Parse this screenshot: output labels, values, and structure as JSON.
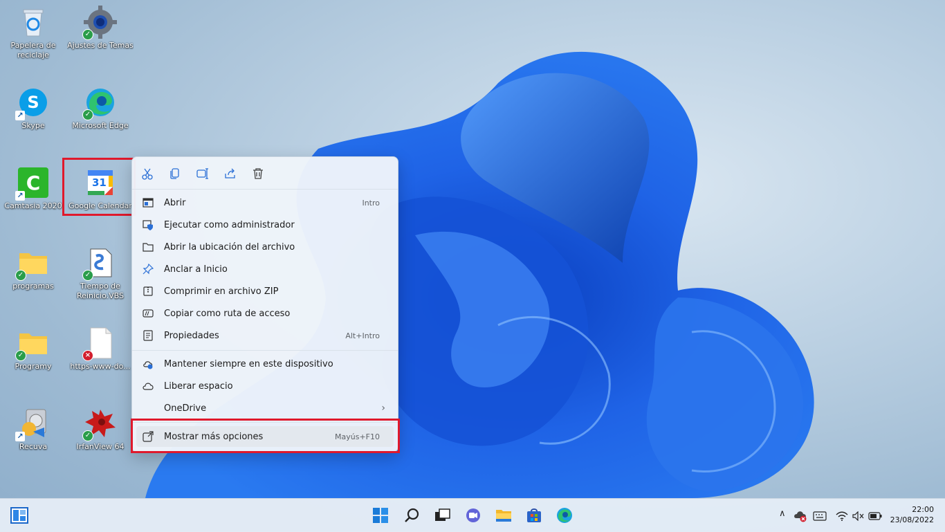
{
  "desktop": {
    "icons": [
      {
        "label": "Papelera de\nreciclaje"
      },
      {
        "label": "Ajustes de Temas"
      },
      {
        "label": "Skype"
      },
      {
        "label": "Microsoft Edge"
      },
      {
        "label": "Camtasia 2020"
      },
      {
        "label": "Google Calendar"
      },
      {
        "label": "programas"
      },
      {
        "label": "Tiempo de\nReinicio.VBS"
      },
      {
        "label": "Programy"
      },
      {
        "label": "https-www-do..."
      },
      {
        "label": "Recuva"
      },
      {
        "label": "IrfanView 64"
      }
    ],
    "calendar_number": "31"
  },
  "context_menu": {
    "items": [
      {
        "label": "Abrir",
        "shortcut": "Intro"
      },
      {
        "label": "Ejecutar como administrador"
      },
      {
        "label": "Abrir la ubicación del archivo"
      },
      {
        "label": "Anclar a Inicio"
      },
      {
        "label": "Comprimir en archivo ZIP"
      },
      {
        "label": "Copiar como ruta de acceso"
      },
      {
        "label": "Propiedades",
        "shortcut": "Alt+Intro"
      },
      {
        "label": "Mantener siempre en este dispositivo"
      },
      {
        "label": "Liberar espacio"
      },
      {
        "label": "OneDrive",
        "arrow": "›"
      },
      {
        "label": "Mostrar más opciones",
        "shortcut": "Mayús+F10"
      }
    ]
  },
  "taskbar": {
    "time": "22:00",
    "date": "23/08/2022",
    "tray_chevron": "∧"
  },
  "colors": {
    "highlight": "#e0192c",
    "accent": "#0067c0"
  }
}
